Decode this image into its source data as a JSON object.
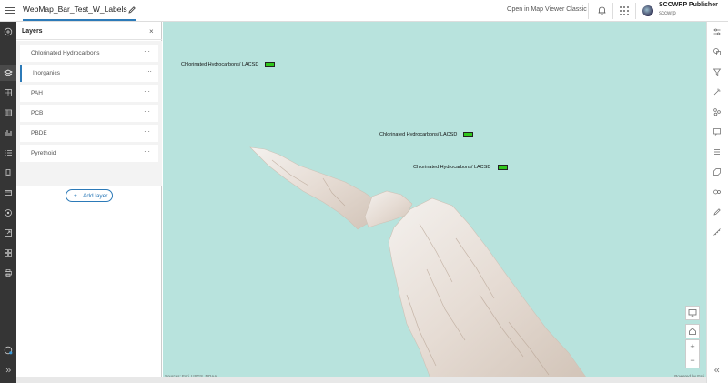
{
  "header": {
    "map_title": "WebMap_Bar_Test_W_Labels",
    "open_classic": "Open in Map Viewer Classic",
    "user_name": "SCCWRP Publisher",
    "user_org": "sccwrp"
  },
  "panel": {
    "title": "Layers",
    "close": "×",
    "layers": [
      {
        "label": "Chlorinated Hydrocarbons",
        "menu": "···"
      },
      {
        "label": "Inorganics",
        "menu": "···"
      },
      {
        "label": "PAH",
        "menu": "···"
      },
      {
        "label": "PCB",
        "menu": "···"
      },
      {
        "label": "PBDE",
        "menu": "···"
      },
      {
        "label": "Pyrethoid",
        "menu": "···"
      }
    ],
    "add_layer_plus": "+",
    "add_layer_label": "Add layer"
  },
  "map": {
    "labels": [
      "Chlorinated Hydrocarbons/ LACSD",
      "Chlorinated Hydrocarbons/ LACSD",
      "Chlorinated Hydrocarbons/ LACSD"
    ],
    "bar_color": "#2fc71c",
    "water_color": "#b8e3dd",
    "attribution_left": "Sources: Esri, USGS, NOAA",
    "attribution_right": "Powered by Esri",
    "zoom_in": "+",
    "zoom_out": "−"
  },
  "icons": {
    "leftbar": [
      "add-icon",
      "layers-icon",
      "basemap-icon",
      "tables-icon",
      "charts-icon",
      "legend-icon",
      "bookmarks-icon",
      "media-icon",
      "properties-icon",
      "share-icon",
      "apps-icon",
      "print-icon",
      "help-icon",
      "collapse-icon"
    ],
    "rightbar": [
      "properties-icon",
      "styles-icon",
      "filter-icon",
      "effects-icon",
      "aggregation-icon",
      "popups-icon",
      "fields-icon",
      "labels-icon",
      "configure-icon",
      "sketch-icon",
      "measure-icon",
      "expand-icon"
    ]
  }
}
